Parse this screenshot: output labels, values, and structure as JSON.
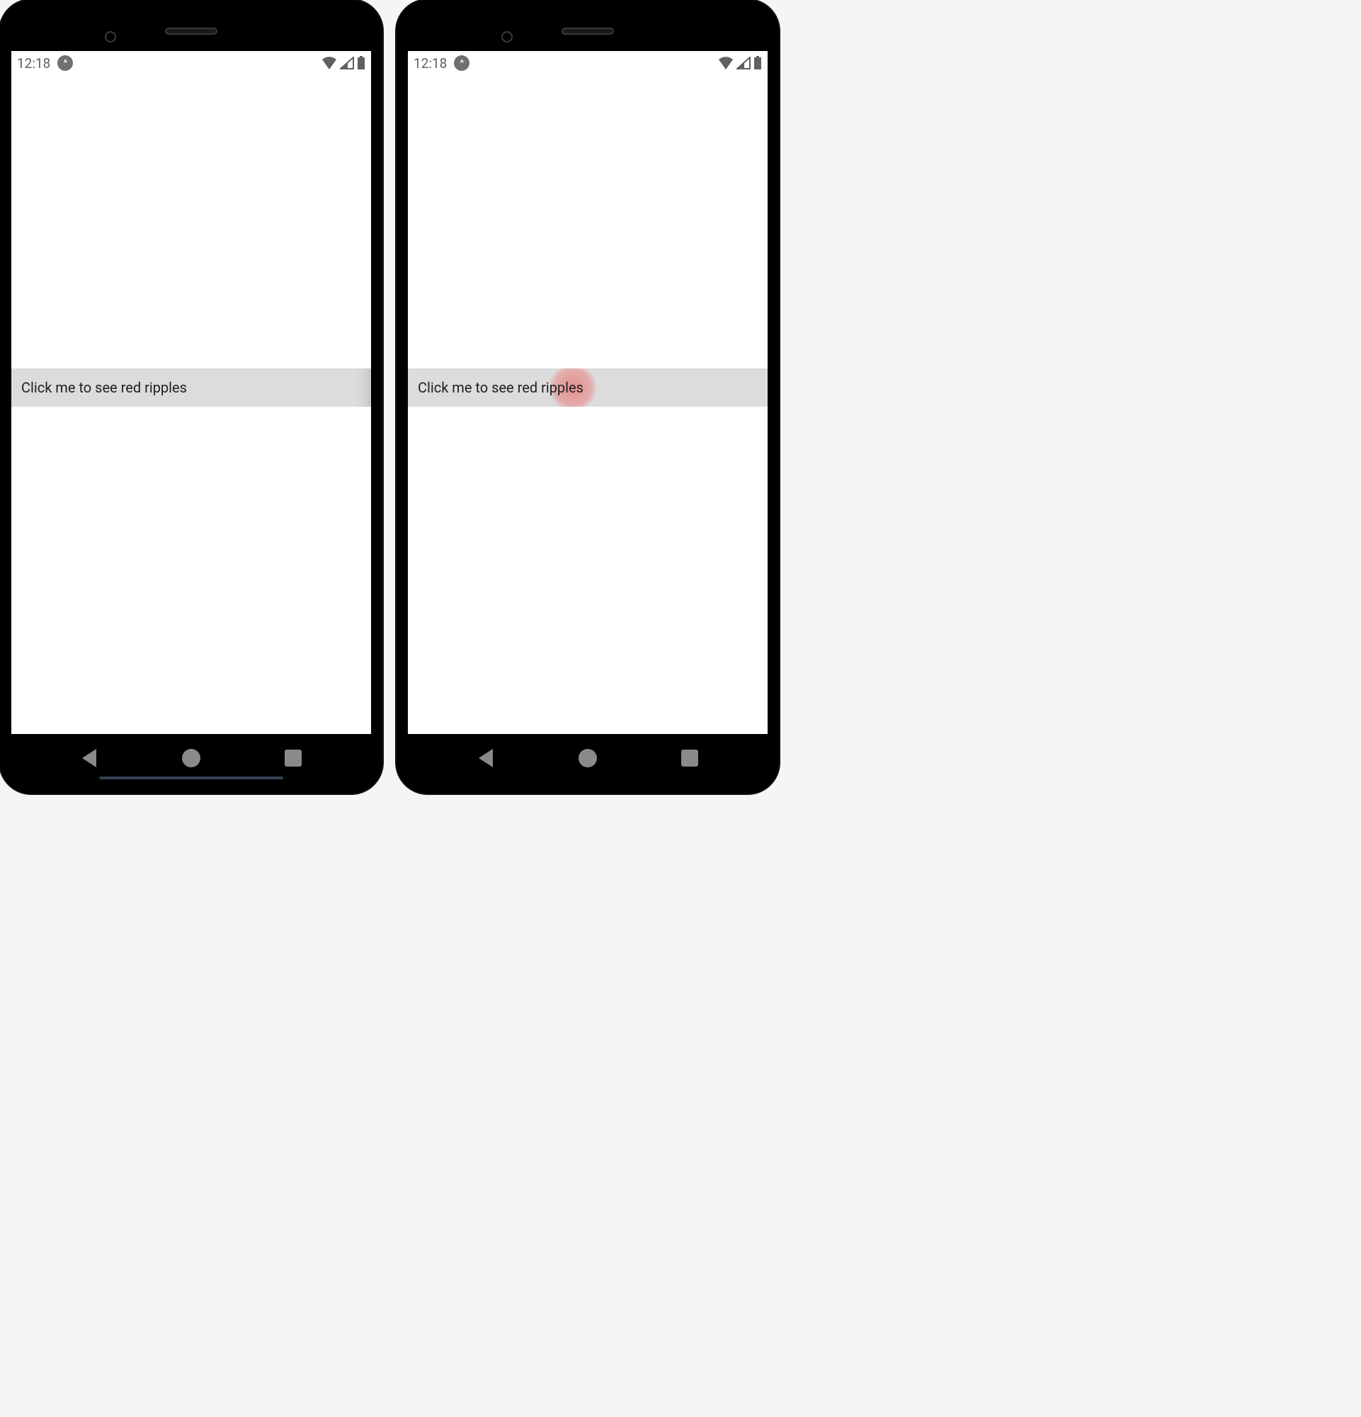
{
  "status": {
    "time": "12:18",
    "badge_symbol": "^",
    "icons": {
      "wifi": "wifi-icon",
      "cell": "cell-icon",
      "battery": "battery-icon"
    }
  },
  "devices": [
    {
      "id": "phone-left",
      "ripple_button": {
        "label": "Click me to see red ripples",
        "show_ripple": false
      },
      "show_gesture_hint": true,
      "shade_right_edge": true
    },
    {
      "id": "phone-right",
      "ripple_button": {
        "label": "Click me to see red ripples",
        "show_ripple": true,
        "ripple_color": "#ef5350"
      },
      "show_gesture_hint": false,
      "shade_right_edge": false
    }
  ],
  "nav": {
    "back": "back-button",
    "home": "home-button",
    "recent": "recent-apps-button"
  }
}
